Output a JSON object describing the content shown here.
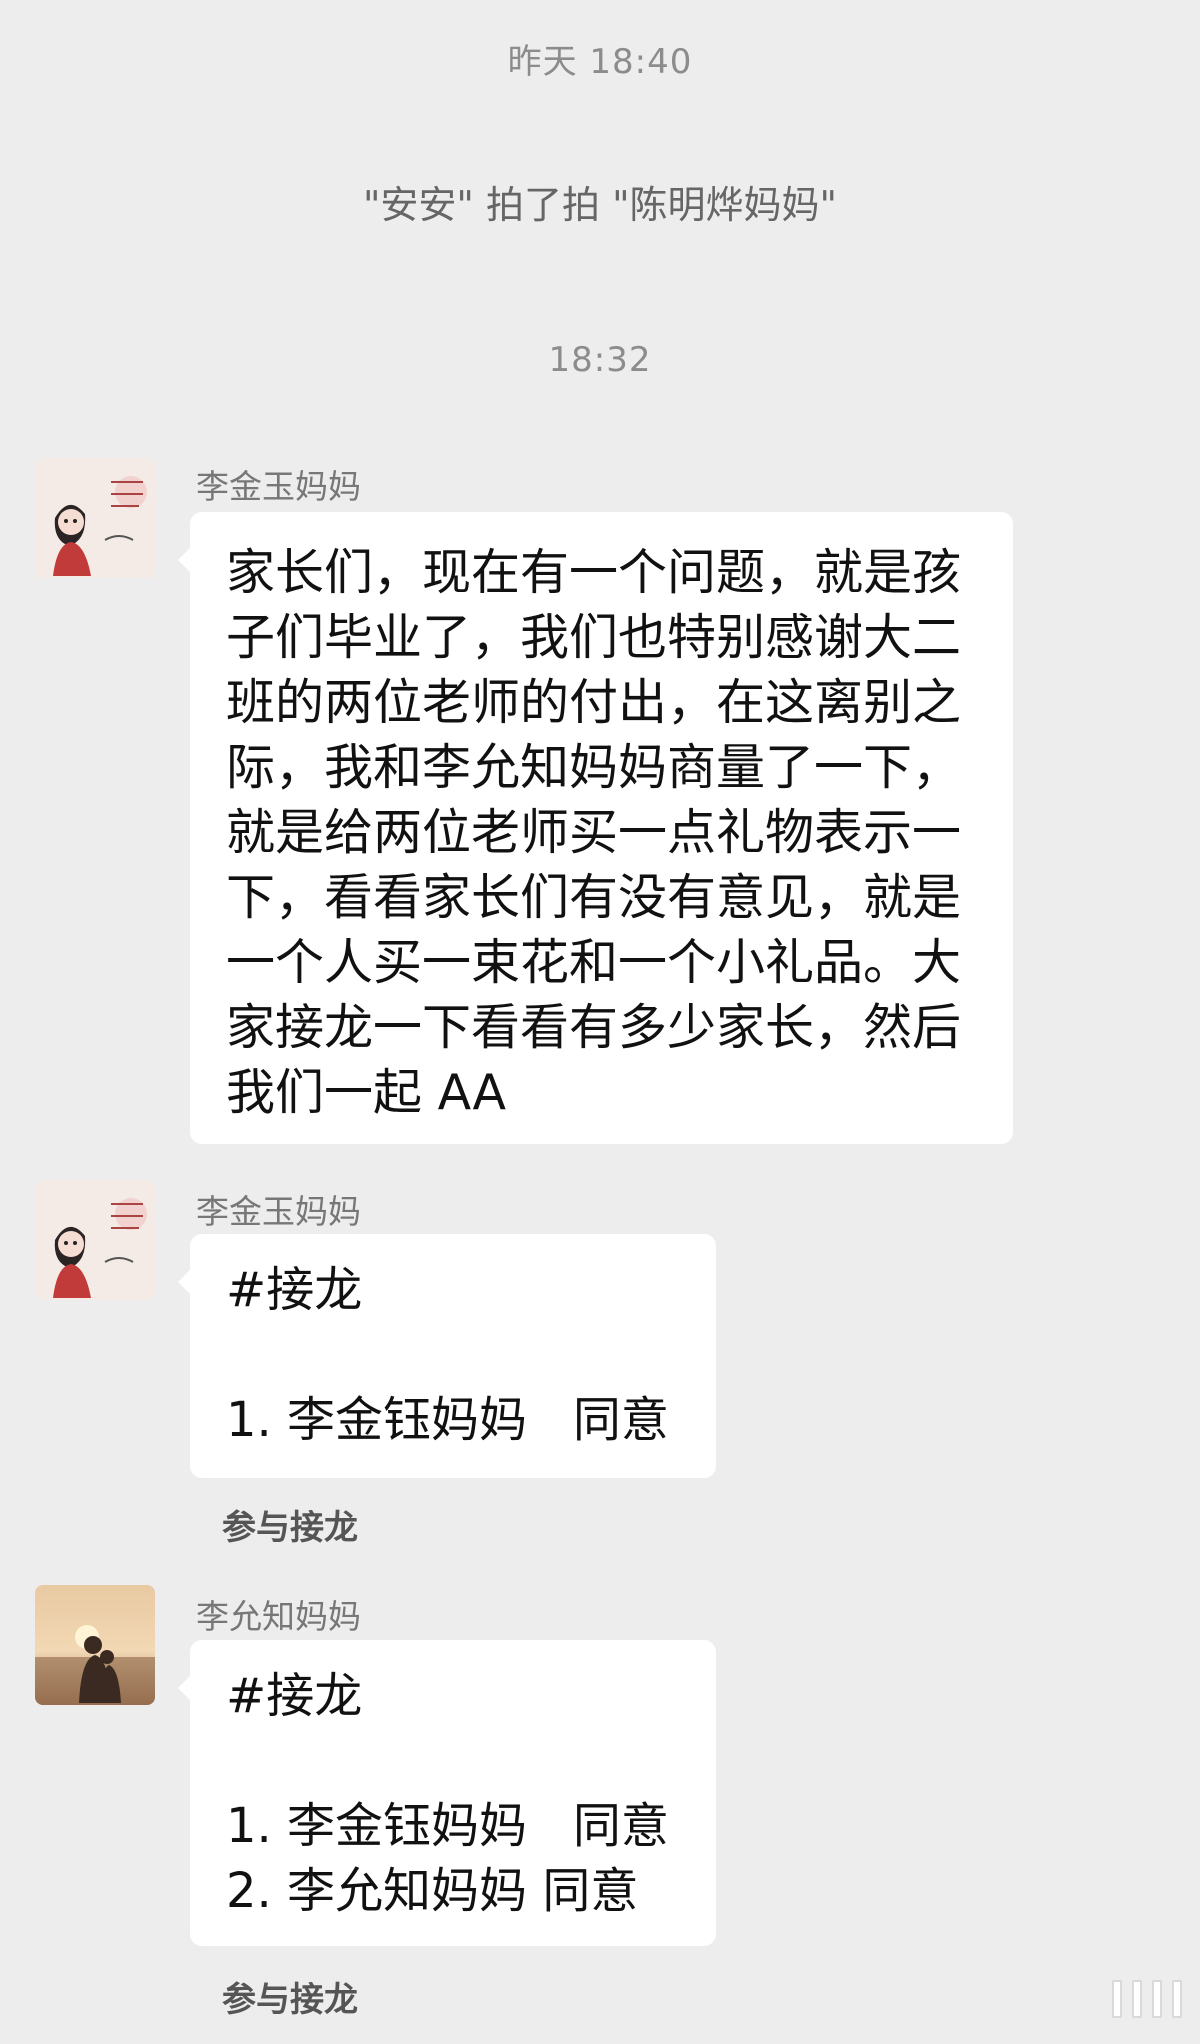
{
  "timestamps": {
    "first": "昨天 18:40",
    "second": "18:32"
  },
  "system_message": "\"安安\" 拍了拍 \"陈明烨妈妈\"",
  "messages": [
    {
      "sender": "李金玉妈妈",
      "avatar": "illustrated-girl-avatar",
      "text": "家长们，现在有一个问题，就是孩子们毕业了，我们也特别感谢大二班的两位老师的付出，在这离别之际，我和李允知妈妈商量了一下，就是给两位老师买一点礼物表示一下，看看家长们有没有意见，就是一个人买一束花和一个小礼品。大家接龙一下看看有多少家长，然后我们一起 AA"
    },
    {
      "sender": "李金玉妈妈",
      "avatar": "illustrated-girl-avatar",
      "relay_title": "#接龙",
      "entries": [
        "1. 李金钰妈妈   同意"
      ],
      "join_label": "参与接龙"
    },
    {
      "sender": "李允知妈妈",
      "avatar": "sunset-silhouette-avatar",
      "relay_title": "#接龙",
      "entries": [
        "1. 李金钰妈妈   同意",
        "2. 李允知妈妈 同意"
      ],
      "join_label": "参与接龙"
    }
  ],
  "colors": {
    "background": "#ededed",
    "bubble": "#ffffff",
    "system_text": "#8c8c8c"
  }
}
